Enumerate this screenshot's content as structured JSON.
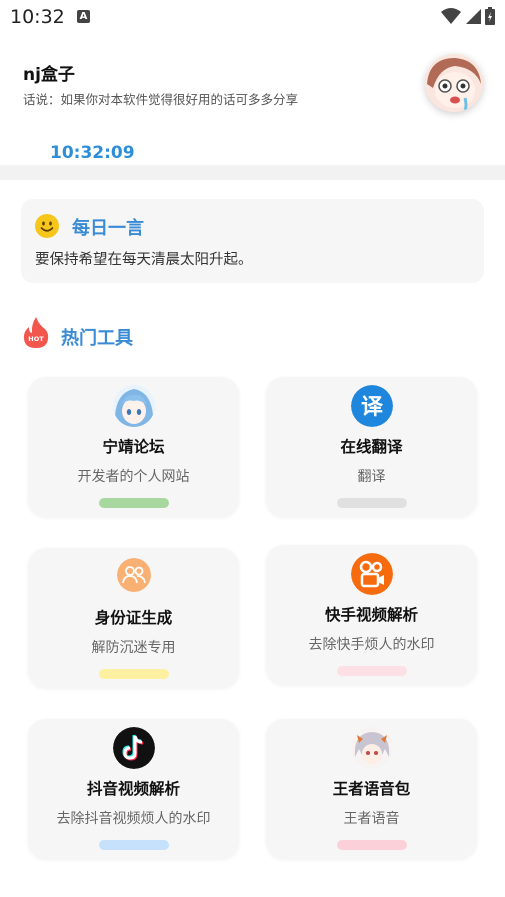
{
  "status_bar": {
    "time": "10:32",
    "notification_icon": "a-icon",
    "icons": [
      "wifi-icon",
      "cellular-signal-icon",
      "battery-icon"
    ]
  },
  "header": {
    "title": "nj盒子",
    "subtitle": "话说：如果你对本软件觉得很好用的话可多多分享",
    "avatar": "anime-avatar",
    "clock": "10:32:09"
  },
  "daily_quote": {
    "icon": "smile-icon",
    "title": "每日一言",
    "text": "要保持希望在每天清晨太阳升起。"
  },
  "hot_tools": {
    "icon": "hot-fire-icon",
    "title": "热门工具",
    "items": [
      {
        "title": "宁靖论坛",
        "desc": "开发者的个人网站",
        "icon": "anime-girl-icon",
        "bar_color": "#a8d8a0"
      },
      {
        "title": "在线翻译",
        "desc": "翻译",
        "icon": "translate-icon",
        "bar_color": "#e0e0e0"
      },
      {
        "title": "身份证生成",
        "desc": "解防沉迷专用",
        "icon": "users-icon",
        "bar_color": "#fdf0a0"
      },
      {
        "title": "快手视频解析",
        "desc": "去除快手烦人的水印",
        "icon": "kuaishou-icon",
        "bar_color": "#fde0e6"
      },
      {
        "title": "抖音视频解析",
        "desc": "去除抖音视频烦人的水印",
        "icon": "tiktok-icon",
        "bar_color": "#c5e1fb"
      },
      {
        "title": "王者语音包",
        "desc": "王者语音",
        "icon": "anime-character-icon",
        "bar_color": "#fcd0d8"
      }
    ]
  },
  "colors": {
    "accent": "#3a8bd6",
    "clock": "#2f8ed8",
    "card_bg": "#f6f6f6"
  }
}
